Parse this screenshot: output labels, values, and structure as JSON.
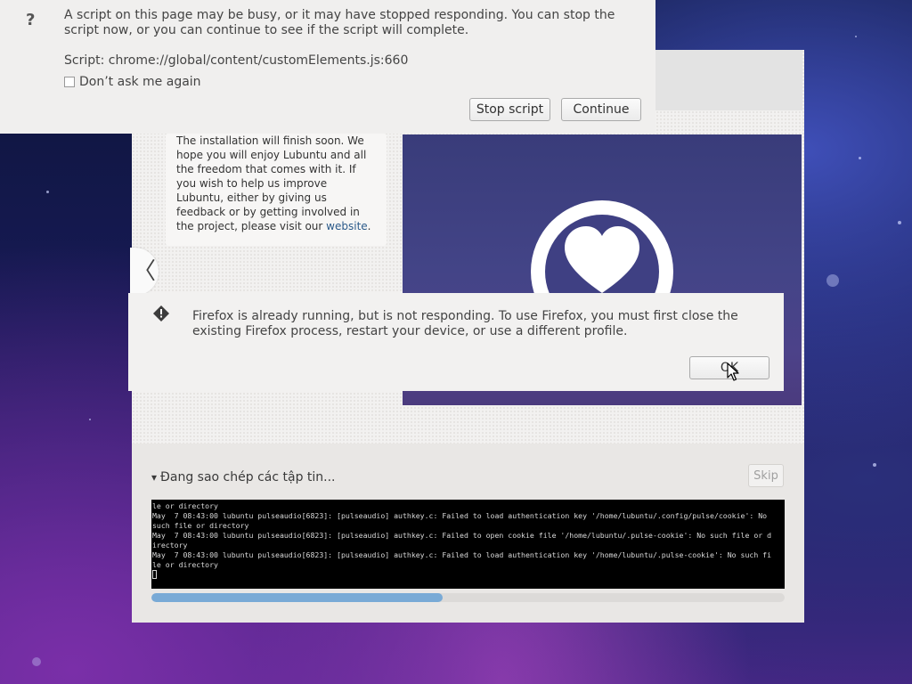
{
  "script_dialog": {
    "icon": "question-icon",
    "icon_glyph": "?",
    "message": "A script on this page may be busy, or it may have stopped responding. You can stop the script now, or you can continue to see if the script will complete.",
    "script_path": "Script: chrome://global/content/customElements.js:660",
    "dont_ask_label": "Don’t ask me again",
    "dont_ask_checked": false,
    "stop_label": "Stop script",
    "continue_label": "Continue"
  },
  "installer": {
    "slide": {
      "text_before_link": "The installation will finish soon. We hope you will enjoy Lubuntu and all the freedom that comes with it. If you wish to help us improve Lubuntu, either by giving us feedback or by getting involved in the project, please visit our ",
      "link_text": "website",
      "text_after_link": ".",
      "prev_glyph": "〈",
      "image_icon": "heart-icon"
    },
    "progress": {
      "expander_glyph": "▾",
      "title": "Đang sao chép các tập tin...",
      "skip_label": "Skip",
      "fraction": 0.46,
      "log": "le or directory\nMay  7 08:43:00 lubuntu pulseaudio[6823]: [pulseaudio] authkey.c: Failed to load authentication key '/home/lubuntu/.config/pulse/cookie': No\nsuch file or directory\nMay  7 08:43:00 lubuntu pulseaudio[6823]: [pulseaudio] authkey.c: Failed to open cookie file '/home/lubuntu/.pulse-cookie': No such file or d\nirectory\nMay  7 08:43:00 lubuntu pulseaudio[6823]: [pulseaudio] authkey.c: Failed to load authentication key '/home/lubuntu/.pulse-cookie': No such fi\nle or directory\n"
    }
  },
  "firefox_dialog": {
    "icon": "warning-icon",
    "message": "Firefox is already running, but is not responding. To use Firefox, you must first close the existing Firefox process, restart your device, or use a different profile.",
    "ok_label": "OK"
  },
  "colors": {
    "progress_fill": "#79aad6",
    "slide_bg": "#434487",
    "link": "#2b5a8a"
  }
}
